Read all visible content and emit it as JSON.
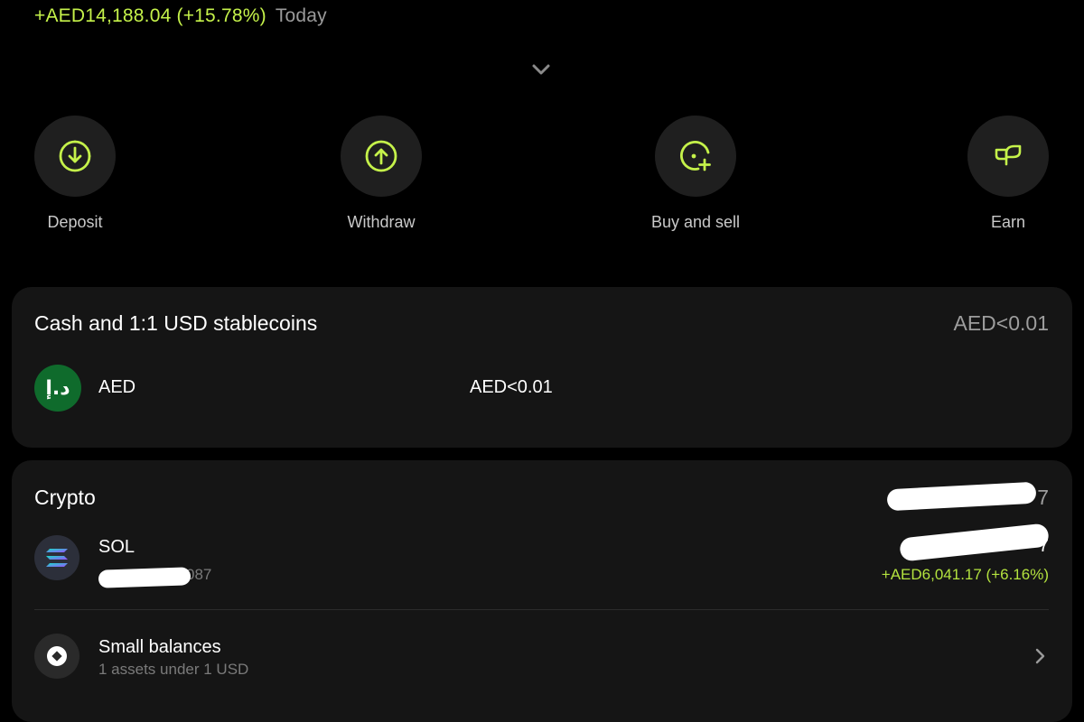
{
  "summary": {
    "change_amount": "+AED14,188.04 (+15.78%)",
    "period": "Today"
  },
  "actions": [
    {
      "label": "Deposit",
      "icon": "download-icon"
    },
    {
      "label": "Withdraw",
      "icon": "upload-icon"
    },
    {
      "label": "Buy and sell",
      "icon": "buy-sell-icon"
    },
    {
      "label": "Earn",
      "icon": "sprout-icon"
    }
  ],
  "cash_section": {
    "title": "Cash and 1:1 USD stablecoins",
    "total": "AED<0.01",
    "rows": [
      {
        "symbol": "AED",
        "coin_glyph": "د.إ",
        "balance": "AED<0.01"
      }
    ]
  },
  "crypto_section": {
    "title": "Crypto",
    "total_visible_fragment": "7",
    "rows": [
      {
        "symbol": "SOL",
        "amount_visible_fragment": "087",
        "value_visible_fragment": "7",
        "change": "+AED6,041.17 (+6.16%)"
      }
    ],
    "small_balances": {
      "title": "Small balances",
      "subtitle": "1 assets under 1 USD"
    }
  },
  "colors": {
    "background": "#000000",
    "card": "#151515",
    "accent_green": "#c5f24a",
    "aed_badge": "#0f6b2c"
  }
}
